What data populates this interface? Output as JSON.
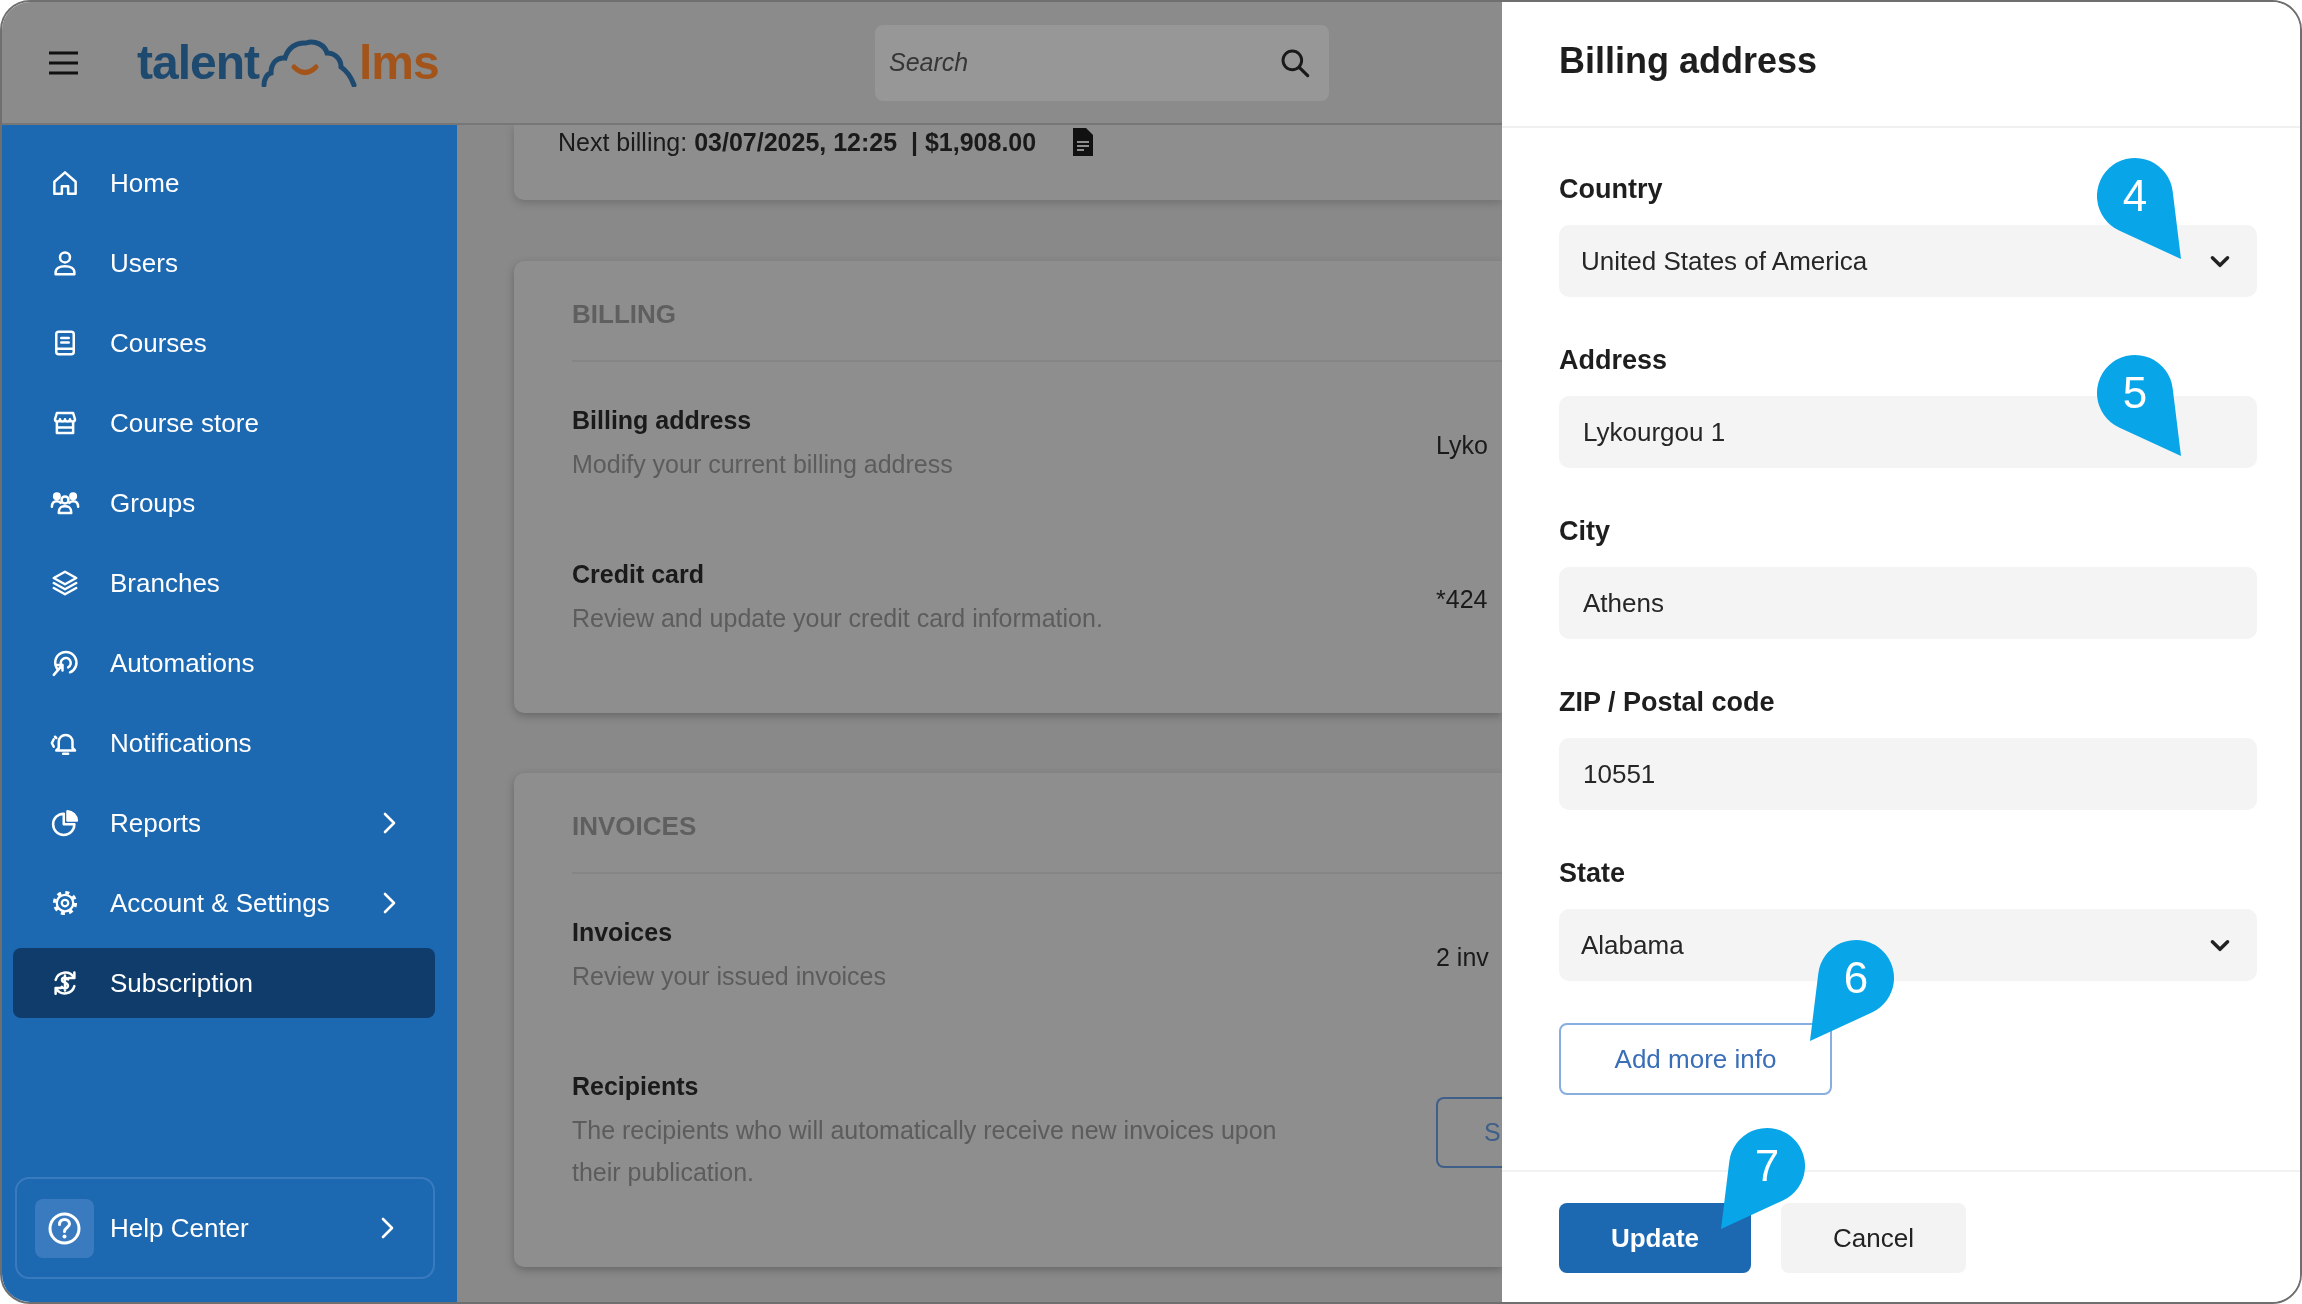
{
  "header": {
    "logo": {
      "left_text": "talent",
      "right_text": "lms"
    },
    "search": {
      "placeholder": "Search"
    }
  },
  "sidebar": {
    "items": [
      {
        "label": "Home",
        "selected": false,
        "submenu": false
      },
      {
        "label": "Users",
        "selected": false,
        "submenu": false
      },
      {
        "label": "Courses",
        "selected": false,
        "submenu": false
      },
      {
        "label": "Course store",
        "selected": false,
        "submenu": false
      },
      {
        "label": "Groups",
        "selected": false,
        "submenu": false
      },
      {
        "label": "Branches",
        "selected": false,
        "submenu": false
      },
      {
        "label": "Automations",
        "selected": false,
        "submenu": false
      },
      {
        "label": "Notifications",
        "selected": false,
        "submenu": false
      },
      {
        "label": "Reports",
        "selected": false,
        "submenu": true
      },
      {
        "label": "Account & Settings",
        "selected": false,
        "submenu": true
      },
      {
        "label": "Subscription",
        "selected": true,
        "submenu": false
      }
    ],
    "help": {
      "label": "Help Center"
    }
  },
  "summary": {
    "text": "Next billing: **03/07/2025, 12:25  | $1,908.00**"
  },
  "sections": [
    {
      "heading": "BILLING",
      "rows": [
        {
          "title": "Billing address",
          "description": "Modify your current billing address",
          "kind": "text",
          "value": "Lyko"
        },
        {
          "title": "Credit card",
          "description": "Review and update your credit card information.",
          "kind": "text",
          "value": "*424"
        }
      ]
    },
    {
      "heading": "INVOICES",
      "rows": [
        {
          "title": "Invoices",
          "description": "Review your issued invoices",
          "kind": "text",
          "value": "2 inv"
        },
        {
          "title": "Recipients",
          "description": "The recipients who will automatically receive new invoices upon their publication.",
          "kind": "button",
          "value": "S"
        }
      ]
    }
  ],
  "panel": {
    "title": "Billing address",
    "fields": [
      {
        "kind": "select",
        "label": "Country",
        "value": "United States of America",
        "callout": "4"
      },
      {
        "kind": "input",
        "label": "Address",
        "value": "Lykourgou 1",
        "callout": "5"
      },
      {
        "kind": "input",
        "label": "City",
        "value": "Athens"
      },
      {
        "kind": "input",
        "label": "ZIP / Postal code",
        "value": "10551"
      },
      {
        "kind": "select",
        "label": "State",
        "value": "Alabama"
      }
    ],
    "more_button": {
      "label": "Add more info",
      "callout": "6"
    },
    "buttons": [
      {
        "kind": "primary",
        "label": "Update",
        "callout": "7"
      },
      {
        "kind": "secondary",
        "label": "Cancel"
      }
    ]
  }
}
